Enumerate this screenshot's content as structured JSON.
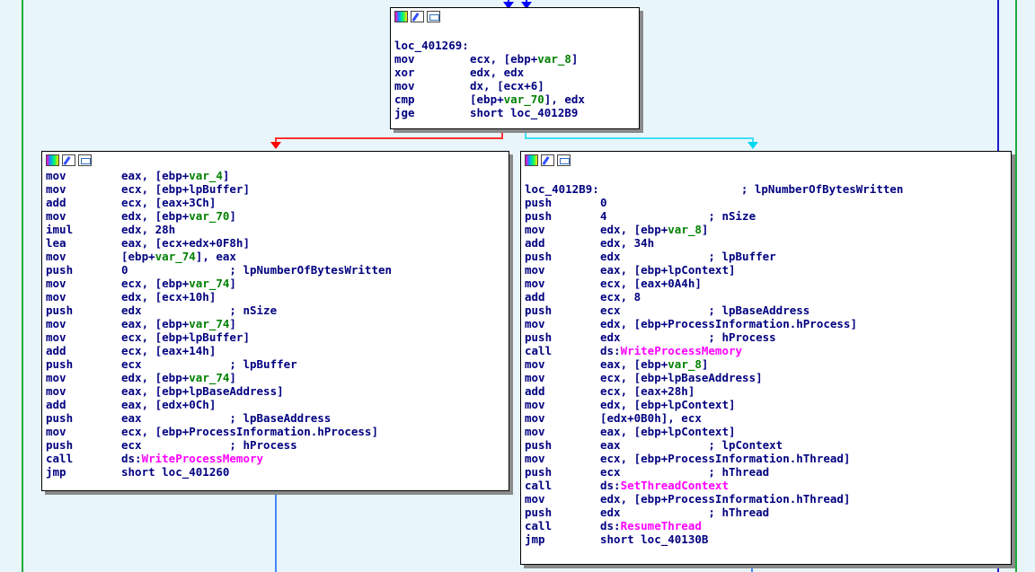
{
  "colors": {
    "background": "#e8f6fc",
    "mnemonic": "#000080",
    "variable": "#008000",
    "api": "#ff00ff",
    "edge_true": "#ff0000",
    "edge_false": "#00e0e0",
    "edge_jump": "#0000ff"
  },
  "toolbar_icons": [
    "color-icon",
    "edit-icon",
    "graph-overview-icon"
  ],
  "node_top": {
    "lines": [
      {
        "label": "loc_401269:"
      },
      {
        "mn": "mov",
        "op": [
          {
            "t": "ecx, [ebp+"
          },
          {
            "v": "var_8"
          },
          {
            "t": "]"
          }
        ]
      },
      {
        "mn": "xor",
        "op": [
          {
            "t": "edx, edx"
          }
        ]
      },
      {
        "mn": "mov",
        "op": [
          {
            "t": "dx, [ecx+6]"
          }
        ]
      },
      {
        "mn": "cmp",
        "op": [
          {
            "t": "[ebp+"
          },
          {
            "v": "var_70"
          },
          {
            "t": "], edx"
          }
        ]
      },
      {
        "mn": "jge",
        "op": [
          {
            "t": "short loc_4012B9"
          }
        ]
      }
    ]
  },
  "node_left": {
    "lines": [
      {
        "mn": "mov",
        "op": [
          {
            "t": "eax, [ebp+"
          },
          {
            "v": "var_4"
          },
          {
            "t": "]"
          }
        ]
      },
      {
        "mn": "mov",
        "op": [
          {
            "t": "ecx, [ebp+lpBuffer]"
          }
        ]
      },
      {
        "mn": "add",
        "op": [
          {
            "t": "ecx, [eax+3Ch]"
          }
        ]
      },
      {
        "mn": "mov",
        "op": [
          {
            "t": "edx, [ebp+"
          },
          {
            "v": "var_70"
          },
          {
            "t": "]"
          }
        ]
      },
      {
        "mn": "imul",
        "op": [
          {
            "t": "edx, 28h"
          }
        ]
      },
      {
        "mn": "lea",
        "op": [
          {
            "t": "eax, [ecx+edx+0F8h]"
          }
        ]
      },
      {
        "mn": "mov",
        "op": [
          {
            "t": "[ebp+"
          },
          {
            "v": "var_74"
          },
          {
            "t": "], eax"
          }
        ]
      },
      {
        "mn": "push",
        "op": [
          {
            "t": "0               ; lpNumberOfBytesWritten"
          }
        ]
      },
      {
        "mn": "mov",
        "op": [
          {
            "t": "ecx, [ebp+"
          },
          {
            "v": "var_74"
          },
          {
            "t": "]"
          }
        ]
      },
      {
        "mn": "mov",
        "op": [
          {
            "t": "edx, [ecx+10h]"
          }
        ]
      },
      {
        "mn": "push",
        "op": [
          {
            "t": "edx             ; nSize"
          }
        ]
      },
      {
        "mn": "mov",
        "op": [
          {
            "t": "eax, [ebp+"
          },
          {
            "v": "var_74"
          },
          {
            "t": "]"
          }
        ]
      },
      {
        "mn": "mov",
        "op": [
          {
            "t": "ecx, [ebp+lpBuffer]"
          }
        ]
      },
      {
        "mn": "add",
        "op": [
          {
            "t": "ecx, [eax+14h]"
          }
        ]
      },
      {
        "mn": "push",
        "op": [
          {
            "t": "ecx             ; lpBuffer"
          }
        ]
      },
      {
        "mn": "mov",
        "op": [
          {
            "t": "edx, [ebp+"
          },
          {
            "v": "var_74"
          },
          {
            "t": "]"
          }
        ]
      },
      {
        "mn": "mov",
        "op": [
          {
            "t": "eax, [ebp+lpBaseAddress]"
          }
        ]
      },
      {
        "mn": "add",
        "op": [
          {
            "t": "eax, [edx+0Ch]"
          }
        ]
      },
      {
        "mn": "push",
        "op": [
          {
            "t": "eax             ; lpBaseAddress"
          }
        ]
      },
      {
        "mn": "mov",
        "op": [
          {
            "t": "ecx, [ebp+ProcessInformation.hProcess]"
          }
        ]
      },
      {
        "mn": "push",
        "op": [
          {
            "t": "ecx             ; hProcess"
          }
        ]
      },
      {
        "mn": "call",
        "op": [
          {
            "t": "ds:"
          },
          {
            "a": "WriteProcessMemory"
          }
        ]
      },
      {
        "mn": "jmp",
        "op": [
          {
            "t": "short loc_401260"
          }
        ]
      }
    ]
  },
  "node_right": {
    "lines": [
      {
        "blank": true
      },
      {
        "label": "loc_4012B9:                     ; lpNumberOfBytesWritten"
      },
      {
        "mn": "push",
        "op": [
          {
            "t": "0"
          }
        ]
      },
      {
        "mn": "push",
        "op": [
          {
            "t": "4               ; nSize"
          }
        ]
      },
      {
        "mn": "mov",
        "op": [
          {
            "t": "edx, [ebp+"
          },
          {
            "v": "var_8"
          },
          {
            "t": "]"
          }
        ]
      },
      {
        "mn": "add",
        "op": [
          {
            "t": "edx, 34h"
          }
        ]
      },
      {
        "mn": "push",
        "op": [
          {
            "t": "edx             ; lpBuffer"
          }
        ]
      },
      {
        "mn": "mov",
        "op": [
          {
            "t": "eax, [ebp+lpContext]"
          }
        ]
      },
      {
        "mn": "mov",
        "op": [
          {
            "t": "ecx, [eax+0A4h]"
          }
        ]
      },
      {
        "mn": "add",
        "op": [
          {
            "t": "ecx, 8"
          }
        ]
      },
      {
        "mn": "push",
        "op": [
          {
            "t": "ecx             ; lpBaseAddress"
          }
        ]
      },
      {
        "mn": "mov",
        "op": [
          {
            "t": "edx, [ebp+ProcessInformation.hProcess]"
          }
        ]
      },
      {
        "mn": "push",
        "op": [
          {
            "t": "edx             ; hProcess"
          }
        ]
      },
      {
        "mn": "call",
        "op": [
          {
            "t": "ds:"
          },
          {
            "a": "WriteProcessMemory"
          }
        ]
      },
      {
        "mn": "mov",
        "op": [
          {
            "t": "eax, [ebp+"
          },
          {
            "v": "var_8"
          },
          {
            "t": "]"
          }
        ]
      },
      {
        "mn": "mov",
        "op": [
          {
            "t": "ecx, [ebp+lpBaseAddress]"
          }
        ]
      },
      {
        "mn": "add",
        "op": [
          {
            "t": "ecx, [eax+28h]"
          }
        ]
      },
      {
        "mn": "mov",
        "op": [
          {
            "t": "edx, [ebp+lpContext]"
          }
        ]
      },
      {
        "mn": "mov",
        "op": [
          {
            "t": "[edx+0B0h], ecx"
          }
        ]
      },
      {
        "mn": "mov",
        "op": [
          {
            "t": "eax, [ebp+lpContext]"
          }
        ]
      },
      {
        "mn": "push",
        "op": [
          {
            "t": "eax             ; lpContext"
          }
        ]
      },
      {
        "mn": "mov",
        "op": [
          {
            "t": "ecx, [ebp+ProcessInformation.hThread]"
          }
        ]
      },
      {
        "mn": "push",
        "op": [
          {
            "t": "ecx             ; hThread"
          }
        ]
      },
      {
        "mn": "call",
        "op": [
          {
            "t": "ds:"
          },
          {
            "a": "SetThreadContext"
          }
        ]
      },
      {
        "mn": "mov",
        "op": [
          {
            "t": "edx, [ebp+ProcessInformation.hThread]"
          }
        ]
      },
      {
        "mn": "push",
        "op": [
          {
            "t": "edx             ; hThread"
          }
        ]
      },
      {
        "mn": "call",
        "op": [
          {
            "t": "ds:"
          },
          {
            "a": "ResumeThread"
          }
        ]
      },
      {
        "mn": "jmp",
        "op": [
          {
            "t": "short loc_40130B"
          }
        ]
      }
    ]
  }
}
